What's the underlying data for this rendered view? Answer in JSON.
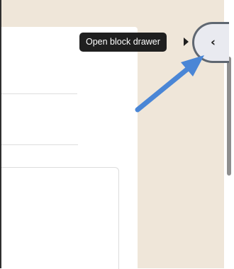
{
  "tooltip": {
    "text": "Open block drawer"
  },
  "drawer_toggle": {
    "icon": "chevron-left-icon",
    "glyph": "‹"
  },
  "colors": {
    "page_background": "#efe6d9",
    "content_background": "#ffffff",
    "tooltip_background": "#1f1f1f",
    "toggle_background": "#e9eaf0",
    "toggle_border": "#5f6771",
    "annotation_arrow": "#4a86d6"
  }
}
